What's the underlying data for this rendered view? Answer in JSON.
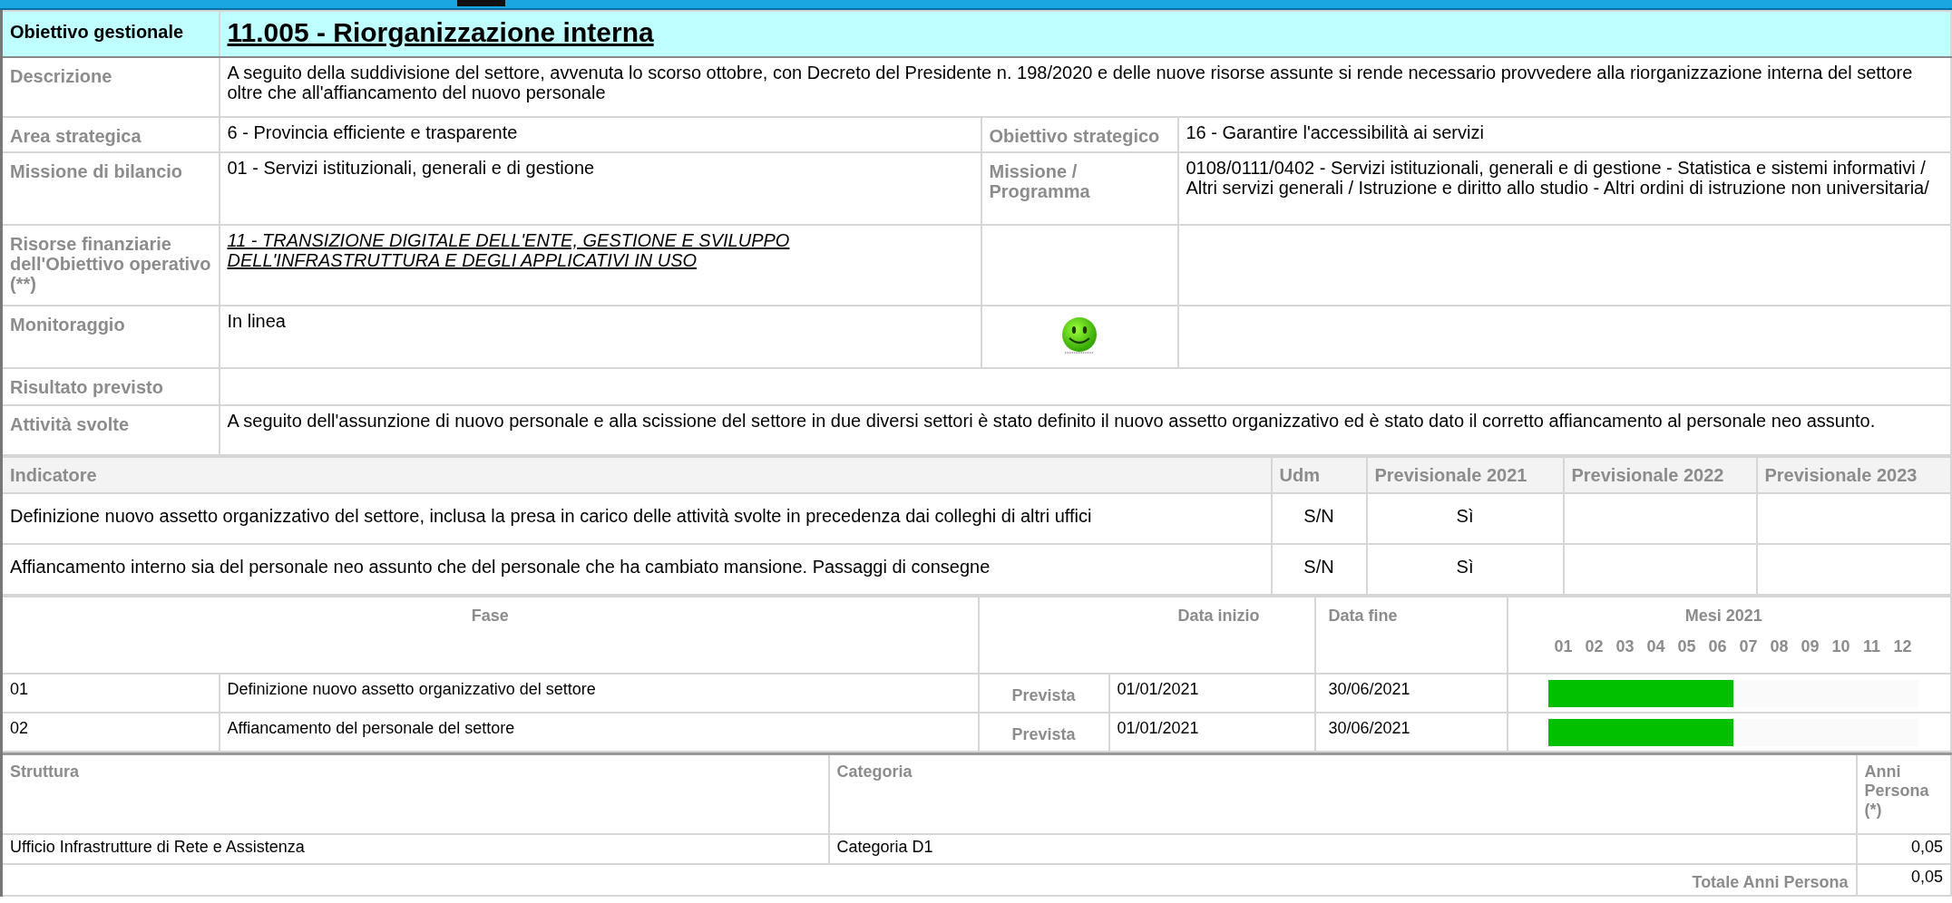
{
  "objective": {
    "label": "Obiettivo gestionale",
    "title": "11.005 - Riorganizzazione interna"
  },
  "details": [
    {
      "kind": "wide",
      "label": "Descrizione",
      "value": "A seguito della suddivisione del settore, avvenuta lo scorso ottobre, con Decreto del Presidente n. 198/2020 e delle nuove risorse assunte si rende necessario provvedere alla riorganizzazione interna del settore oltre che all'affiancamento del nuovo personale"
    },
    {
      "kind": "split",
      "label": "Area strategica",
      "value": "6 - Provincia efficiente e trasparente",
      "label_2": "Obiettivo strategico",
      "value_2": "16 - Garantire l'accessibilità ai servizi"
    },
    {
      "kind": "split",
      "label": "Missione di bilancio",
      "value": "01 - Servizi istituzionali, generali e di gestione",
      "label_2": "Missione / Programma",
      "value_2": "0108/0111/0402 - Servizi istituzionali, generali e di gestione - Statistica e sistemi informativi / Altri servizi generali / Istruzione e diritto allo studio - Altri ordini di istruzione non universitaria/"
    },
    {
      "kind": "link",
      "label": "Risorse finanziarie dell'Obiettivo operativo (**)",
      "value": "11 - TRANSIZIONE DIGITALE DELL'ENTE, GESTIONE E SVILUPPO DELL'INFRASTRUTTURA E DEGLI APPLICATIVI IN USO"
    },
    {
      "kind": "status",
      "label": "Monitoraggio",
      "value": "In linea"
    },
    {
      "kind": "wide",
      "label": "Risultato previsto"
    },
    {
      "kind": "wide",
      "label": "Attività svolte",
      "value": "A seguito dell'assunzione di nuovo personale e alla scissione del settore in due diversi settori è stato definito il nuovo assetto organizzativo ed è stato dato il corretto affiancamento al personale neo assunto."
    }
  ],
  "indicators": {
    "columns": [
      "Indicatore",
      "Udm",
      "Previsionale 2021",
      "Previsionale 2022",
      "Previsionale 2023"
    ],
    "rows": [
      {
        "cells": [
          "Definizione nuovo assetto organizzativo del settore, inclusa la presa in carico delle attività svolte in precedenza dai colleghi di altri uffici",
          "S/N",
          "Sì"
        ]
      },
      {
        "cells": [
          "Affiancamento interno sia del personale neo assunto che  del personale che ha cambiato mansione. Passaggi di consegne",
          "S/N",
          "Sì"
        ]
      }
    ]
  },
  "phases": {
    "columns": {
      "phase": "Fase",
      "start": "Data inizio",
      "end": "Data fine",
      "months_title": "Mesi 2021"
    },
    "months": [
      "01",
      "02",
      "03",
      "04",
      "05",
      "06",
      "07",
      "08",
      "09",
      "10",
      "11",
      "12"
    ],
    "rows": [
      {
        "code": "01",
        "name": "Definizione nuovo assetto organizzativo del settore",
        "type": "Prevista",
        "start": "01/01/2021",
        "end": "30/06/2021",
        "level": 0.5
      },
      {
        "code": "02",
        "name": "Affiancamento del personale del settore",
        "type": "Prevista",
        "start": "01/01/2021",
        "end": "30/06/2021",
        "level": 0.5
      }
    ]
  },
  "staffing": {
    "columns": [
      "Struttura",
      "Categoria",
      "Anni Persona (*)"
    ],
    "rows": [
      {
        "cells": [
          "Ufficio Infrastrutture di Rete e Assistenza",
          "Categoria D1",
          "0,05"
        ]
      }
    ],
    "total_label": "Totale Anni Persona",
    "total": "0,05"
  }
}
